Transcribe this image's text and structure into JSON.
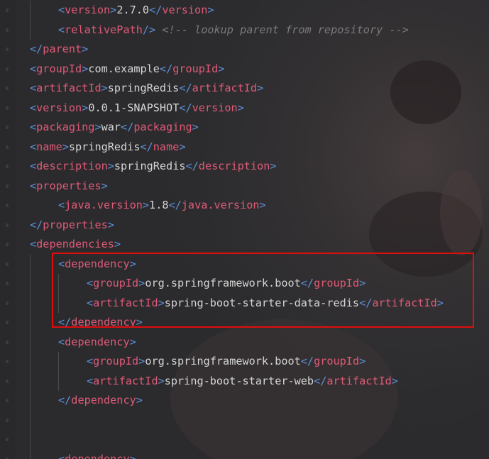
{
  "editor": {
    "lines": [
      {
        "indent": 2,
        "open": "version",
        "text": "2.7.0",
        "close": "version"
      },
      {
        "indent": 2,
        "selfclose": "relativePath",
        "comment": "<!-- lookup parent from repository -->"
      },
      {
        "indent": 1,
        "closeonly": "parent"
      },
      {
        "indent": 1,
        "open": "groupId",
        "text": "com.example",
        "close": "groupId"
      },
      {
        "indent": 1,
        "open": "artifactId",
        "text": "springRedis",
        "close": "artifactId"
      },
      {
        "indent": 1,
        "open": "version",
        "text": "0.0.1-SNAPSHOT",
        "close": "version"
      },
      {
        "indent": 1,
        "open": "packaging",
        "text": "war",
        "close": "packaging"
      },
      {
        "indent": 1,
        "open": "name",
        "text": "springRedis",
        "close": "name"
      },
      {
        "indent": 1,
        "open": "description",
        "text": "springRedis",
        "close": "description"
      },
      {
        "indent": 1,
        "openonly": "properties"
      },
      {
        "indent": 2,
        "open": "java.version",
        "text": "1.8",
        "close": "java.version"
      },
      {
        "indent": 1,
        "closeonly": "properties"
      },
      {
        "indent": 1,
        "openonly": "dependencies"
      },
      {
        "indent": 2,
        "openonly": "dependency"
      },
      {
        "indent": 3,
        "open": "groupId",
        "text": "org.springframework.boot",
        "close": "groupId"
      },
      {
        "indent": 3,
        "open": "artifactId",
        "text": "spring-boot-starter-data-redis",
        "close": "artifactId"
      },
      {
        "indent": 2,
        "closeonly": "dependency"
      },
      {
        "indent": 2,
        "openonly": "dependency"
      },
      {
        "indent": 3,
        "open": "groupId",
        "text": "org.springframework.boot",
        "close": "groupId"
      },
      {
        "indent": 3,
        "open": "artifactId",
        "text": "spring-boot-starter-web",
        "close": "artifactId"
      },
      {
        "indent": 2,
        "closeonly": "dependency"
      },
      {
        "indent": 0,
        "blank": true
      },
      {
        "indent": 0,
        "blank": true
      },
      {
        "indent": 2,
        "openonly": "dependency"
      }
    ]
  },
  "highlight": {
    "label": "highlighted-dependency",
    "color": "#e00d0d"
  },
  "colors": {
    "background": "#2b2b2e",
    "bracket": "#5c8fd6",
    "tag_name": "#e05a77",
    "text": "#d5d5d5",
    "comment": "#7a7a7a"
  }
}
